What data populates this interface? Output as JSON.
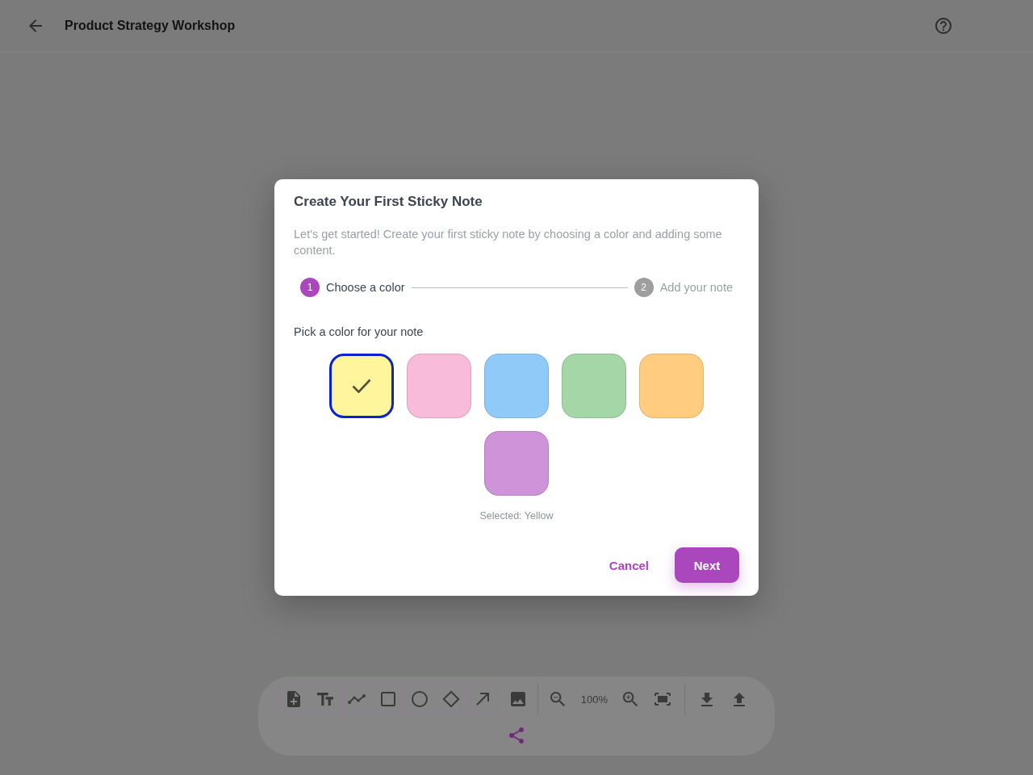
{
  "header": {
    "title": "Product Strategy Workshop"
  },
  "dialog": {
    "title": "Create Your First Sticky Note",
    "description": "Let's get started! Create your first sticky note by choosing a color and adding some content.",
    "steps": [
      {
        "number": "1",
        "label": "Choose a color",
        "selected": true
      },
      {
        "number": "2",
        "label": "Add your note",
        "selected": false
      }
    ],
    "prompt": "Pick a color for your note",
    "swatches": [
      {
        "color": "#fff59d",
        "selected": true
      },
      {
        "color": "#f8bbd9",
        "selected": false
      },
      {
        "color": "#90caf9",
        "selected": false
      },
      {
        "color": "#a5d6a7",
        "selected": false
      },
      {
        "color": "#ffcc80",
        "selected": false
      },
      {
        "color": "#ce93d8",
        "selected": false
      }
    ],
    "selection_text": "Selected: Yellow",
    "buttons": [
      {
        "label": "Cancel",
        "kind": "text"
      },
      {
        "label": "Next",
        "kind": "primary"
      }
    ]
  },
  "toolbar": {
    "zoom_level": "100%"
  }
}
